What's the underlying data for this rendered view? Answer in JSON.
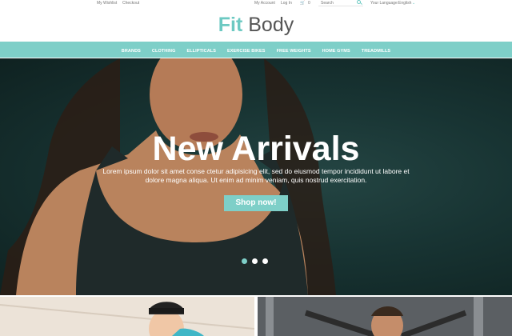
{
  "topbar": {
    "wishlist": "My Wishlist",
    "checkout": "Checkout",
    "account": "My Account",
    "login": "Log In",
    "cart_count": "0",
    "search_placeholder": "Search",
    "language_label": "Your Language:",
    "language_value": "English"
  },
  "logo": {
    "part1": "Fit",
    "part2": "Body"
  },
  "nav": {
    "items": [
      "BRANDS",
      "CLOTHING",
      "ELLIPTICALS",
      "EXERCISE BIKES",
      "FREE WEIGHTS",
      "HOME GYMS",
      "TREADMILLS"
    ]
  },
  "hero": {
    "title": "New Arrivals",
    "text": "Lorem ipsum dolor sit amet conse ctetur adipisicing elit, sed do eiusmod tempor incididunt ut labore et dolore magna aliqua. Ut enim ad minim veniam, quis nostrud exercitation.",
    "button": "Shop now!",
    "slides_total": 3,
    "active_slide": 1
  },
  "colors": {
    "accent": "#7ecfc8",
    "logo_accent": "#6cc9c2",
    "hero_bg": "#183433"
  },
  "icons": [
    "cart-icon",
    "search-icon",
    "chevron-down-icon"
  ]
}
